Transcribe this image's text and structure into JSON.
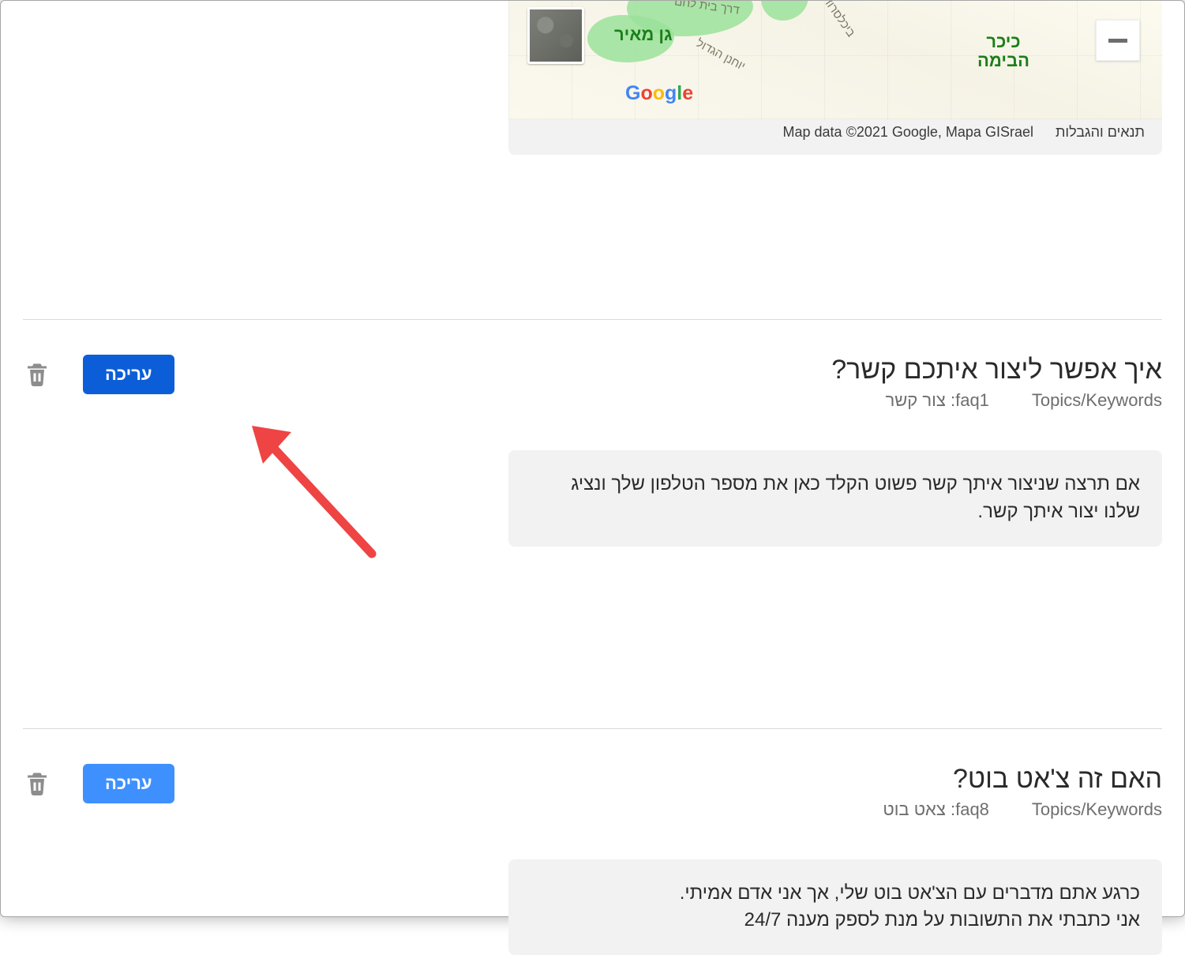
{
  "map": {
    "park_label": "גן מאיר",
    "place_label": "כיכר\nהבימה",
    "roads": [
      "דרך בית לחם",
      "יוחנן הגדול",
      "ביכלסרוד"
    ],
    "logo_letters": [
      "G",
      "o",
      "o",
      "g",
      "l",
      "e"
    ],
    "attribution": "Map data ©2021 Google, Mapa GISrael",
    "terms": "תנאים והגבלות"
  },
  "faqs": [
    {
      "title": "איך אפשר ליצור איתכם קשר?",
      "keywords_label": "Topics/Keywords",
      "faq_id": "faq1",
      "keyword": "צור קשר",
      "answer": "אם תרצה שניצור איתך קשר פשוט הקלד כאן את מספר הטלפון שלך ונציג שלנו יצור איתך קשר.",
      "edit_label": "עריכה",
      "primary": true
    },
    {
      "title": "האם זה צ'אט בוט?",
      "keywords_label": "Topics/Keywords",
      "faq_id": "faq8",
      "keyword": "צאט בוט",
      "answer": "כרגע אתם מדברים עם הצ'אט בוט שלי, אך אני אדם אמיתי.\nאני כתבתי את התשובות על מנת לספק מענה 24/7",
      "edit_label": "עריכה",
      "primary": false
    }
  ]
}
